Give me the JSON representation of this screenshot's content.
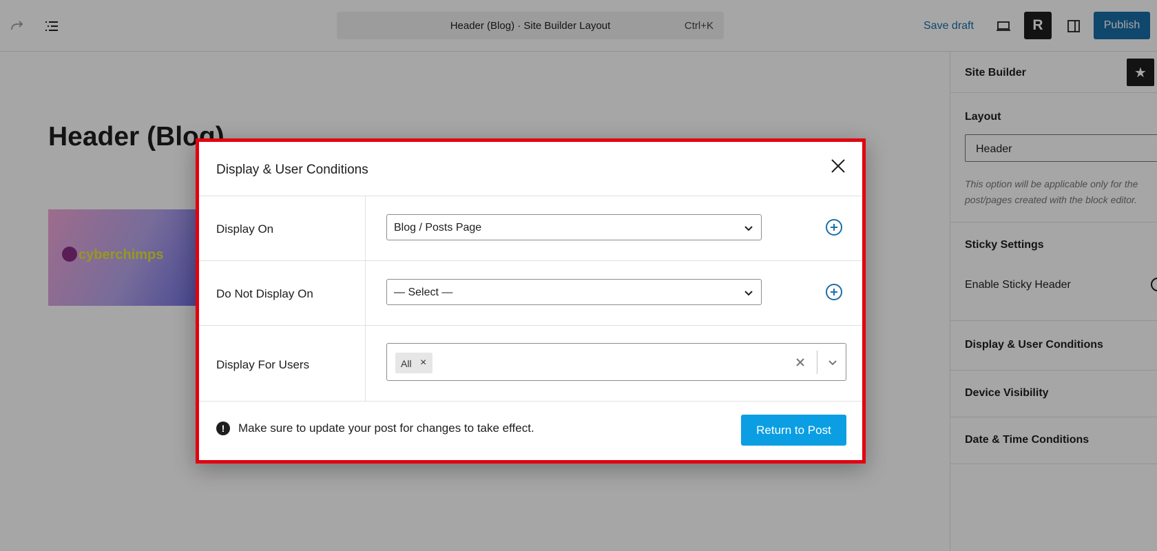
{
  "topbar": {
    "command_title": "Header (Blog) · Site Builder Layout",
    "command_shortcut": "Ctrl+K",
    "save_draft_label": "Save draft",
    "plugin_button_label": "R",
    "publish_label": "Publish",
    "accent_color": "#1a6ea6"
  },
  "canvas": {
    "page_title": "Header (Blog)",
    "logo_text": "cyberchimps"
  },
  "sidebar": {
    "panel_title": "Site Builder",
    "layout": {
      "title": "Layout",
      "selected": "Header",
      "help_text": "This option will be applicable only for the post/pages created with the block editor."
    },
    "sticky": {
      "title": "Sticky Settings",
      "toggle_label": "Enable Sticky Header"
    },
    "sections": [
      "Display & User Conditions",
      "Device Visibility",
      "Date & Time Conditions"
    ]
  },
  "modal": {
    "title": "Display & User Conditions",
    "rows": [
      {
        "label": "Display On",
        "value": "Blog / Posts Page"
      },
      {
        "label": "Do Not Display On",
        "value": "— Select —"
      },
      {
        "label": "Display For Users",
        "chips": [
          "All"
        ]
      }
    ],
    "footer_note": "Make sure to update your post for changes to take effect.",
    "return_label": "Return to Post",
    "highlight_color": "#e3000f",
    "button_color": "#0b9ee3"
  }
}
